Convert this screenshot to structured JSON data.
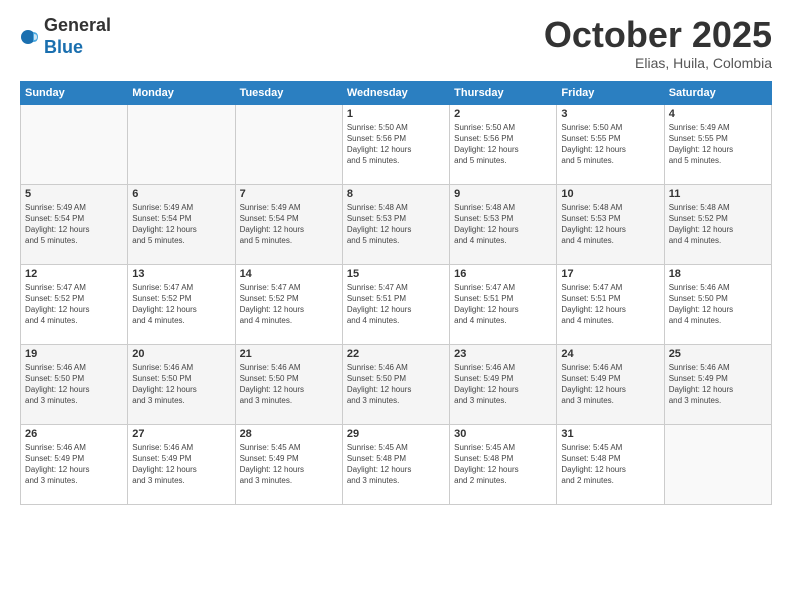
{
  "header": {
    "logo_general": "General",
    "logo_blue": "Blue",
    "month_title": "October 2025",
    "location": "Elias, Huila, Colombia"
  },
  "days_of_week": [
    "Sunday",
    "Monday",
    "Tuesday",
    "Wednesday",
    "Thursday",
    "Friday",
    "Saturday"
  ],
  "weeks": [
    [
      {
        "day": "",
        "info": ""
      },
      {
        "day": "",
        "info": ""
      },
      {
        "day": "",
        "info": ""
      },
      {
        "day": "1",
        "info": "Sunrise: 5:50 AM\nSunset: 5:56 PM\nDaylight: 12 hours\nand 5 minutes."
      },
      {
        "day": "2",
        "info": "Sunrise: 5:50 AM\nSunset: 5:56 PM\nDaylight: 12 hours\nand 5 minutes."
      },
      {
        "day": "3",
        "info": "Sunrise: 5:50 AM\nSunset: 5:55 PM\nDaylight: 12 hours\nand 5 minutes."
      },
      {
        "day": "4",
        "info": "Sunrise: 5:49 AM\nSunset: 5:55 PM\nDaylight: 12 hours\nand 5 minutes."
      }
    ],
    [
      {
        "day": "5",
        "info": "Sunrise: 5:49 AM\nSunset: 5:54 PM\nDaylight: 12 hours\nand 5 minutes."
      },
      {
        "day": "6",
        "info": "Sunrise: 5:49 AM\nSunset: 5:54 PM\nDaylight: 12 hours\nand 5 minutes."
      },
      {
        "day": "7",
        "info": "Sunrise: 5:49 AM\nSunset: 5:54 PM\nDaylight: 12 hours\nand 5 minutes."
      },
      {
        "day": "8",
        "info": "Sunrise: 5:48 AM\nSunset: 5:53 PM\nDaylight: 12 hours\nand 5 minutes."
      },
      {
        "day": "9",
        "info": "Sunrise: 5:48 AM\nSunset: 5:53 PM\nDaylight: 12 hours\nand 4 minutes."
      },
      {
        "day": "10",
        "info": "Sunrise: 5:48 AM\nSunset: 5:53 PM\nDaylight: 12 hours\nand 4 minutes."
      },
      {
        "day": "11",
        "info": "Sunrise: 5:48 AM\nSunset: 5:52 PM\nDaylight: 12 hours\nand 4 minutes."
      }
    ],
    [
      {
        "day": "12",
        "info": "Sunrise: 5:47 AM\nSunset: 5:52 PM\nDaylight: 12 hours\nand 4 minutes."
      },
      {
        "day": "13",
        "info": "Sunrise: 5:47 AM\nSunset: 5:52 PM\nDaylight: 12 hours\nand 4 minutes."
      },
      {
        "day": "14",
        "info": "Sunrise: 5:47 AM\nSunset: 5:52 PM\nDaylight: 12 hours\nand 4 minutes."
      },
      {
        "day": "15",
        "info": "Sunrise: 5:47 AM\nSunset: 5:51 PM\nDaylight: 12 hours\nand 4 minutes."
      },
      {
        "day": "16",
        "info": "Sunrise: 5:47 AM\nSunset: 5:51 PM\nDaylight: 12 hours\nand 4 minutes."
      },
      {
        "day": "17",
        "info": "Sunrise: 5:47 AM\nSunset: 5:51 PM\nDaylight: 12 hours\nand 4 minutes."
      },
      {
        "day": "18",
        "info": "Sunrise: 5:46 AM\nSunset: 5:50 PM\nDaylight: 12 hours\nand 4 minutes."
      }
    ],
    [
      {
        "day": "19",
        "info": "Sunrise: 5:46 AM\nSunset: 5:50 PM\nDaylight: 12 hours\nand 3 minutes."
      },
      {
        "day": "20",
        "info": "Sunrise: 5:46 AM\nSunset: 5:50 PM\nDaylight: 12 hours\nand 3 minutes."
      },
      {
        "day": "21",
        "info": "Sunrise: 5:46 AM\nSunset: 5:50 PM\nDaylight: 12 hours\nand 3 minutes."
      },
      {
        "day": "22",
        "info": "Sunrise: 5:46 AM\nSunset: 5:50 PM\nDaylight: 12 hours\nand 3 minutes."
      },
      {
        "day": "23",
        "info": "Sunrise: 5:46 AM\nSunset: 5:49 PM\nDaylight: 12 hours\nand 3 minutes."
      },
      {
        "day": "24",
        "info": "Sunrise: 5:46 AM\nSunset: 5:49 PM\nDaylight: 12 hours\nand 3 minutes."
      },
      {
        "day": "25",
        "info": "Sunrise: 5:46 AM\nSunset: 5:49 PM\nDaylight: 12 hours\nand 3 minutes."
      }
    ],
    [
      {
        "day": "26",
        "info": "Sunrise: 5:46 AM\nSunset: 5:49 PM\nDaylight: 12 hours\nand 3 minutes."
      },
      {
        "day": "27",
        "info": "Sunrise: 5:46 AM\nSunset: 5:49 PM\nDaylight: 12 hours\nand 3 minutes."
      },
      {
        "day": "28",
        "info": "Sunrise: 5:45 AM\nSunset: 5:49 PM\nDaylight: 12 hours\nand 3 minutes."
      },
      {
        "day": "29",
        "info": "Sunrise: 5:45 AM\nSunset: 5:48 PM\nDaylight: 12 hours\nand 3 minutes."
      },
      {
        "day": "30",
        "info": "Sunrise: 5:45 AM\nSunset: 5:48 PM\nDaylight: 12 hours\nand 2 minutes."
      },
      {
        "day": "31",
        "info": "Sunrise: 5:45 AM\nSunset: 5:48 PM\nDaylight: 12 hours\nand 2 minutes."
      },
      {
        "day": "",
        "info": ""
      }
    ]
  ]
}
